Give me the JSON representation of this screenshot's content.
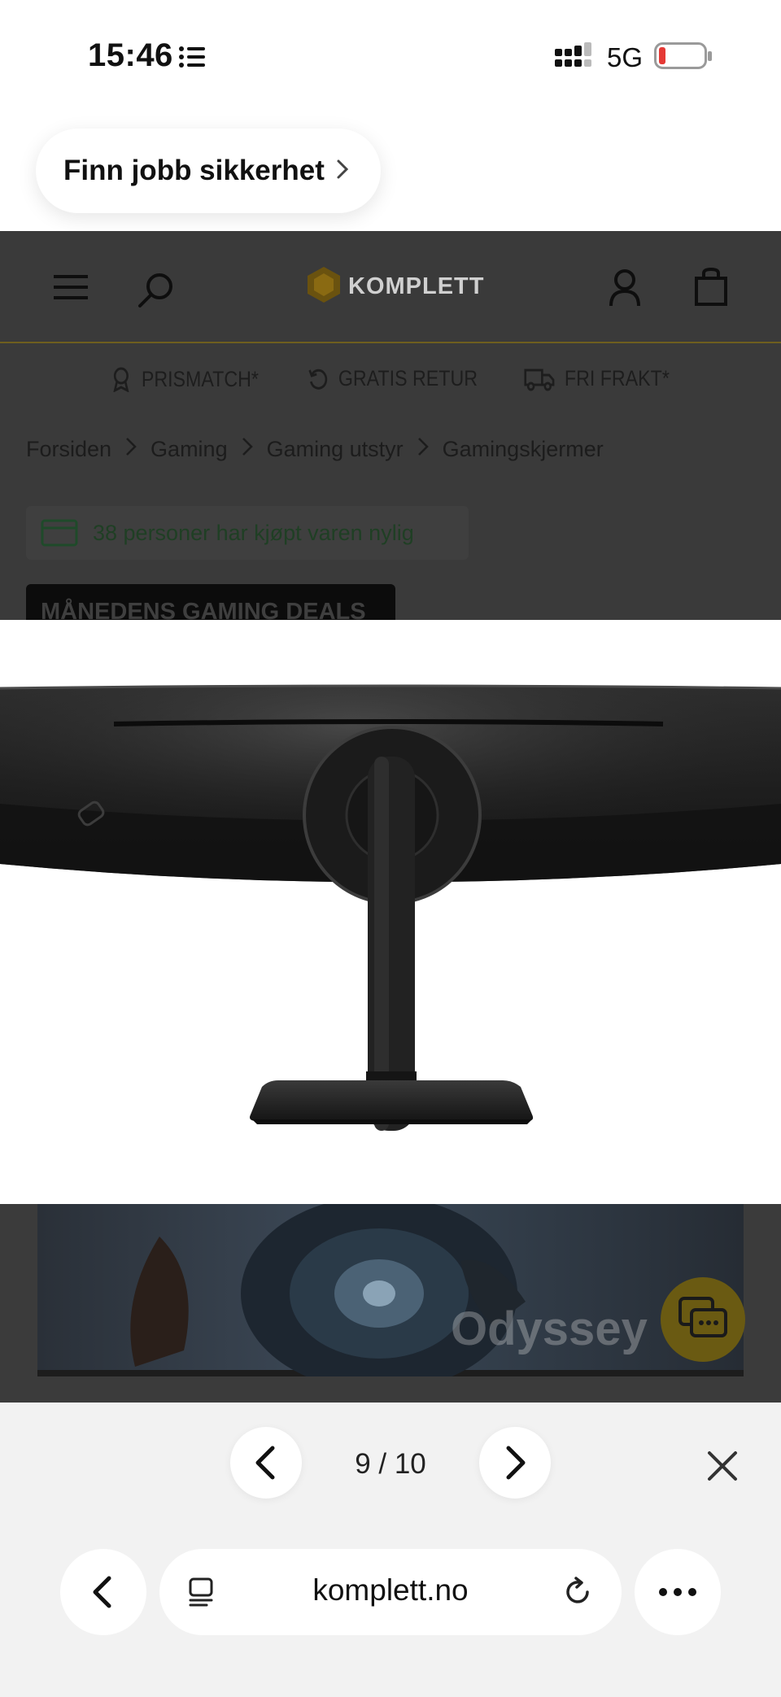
{
  "status_bar": {
    "time": "15:46",
    "network": "5G",
    "battery_color": "#e53935"
  },
  "banner": {
    "label": "Finn jobb sikkerhet"
  },
  "site": {
    "brand": "KOMPLETT",
    "accent_color": "#f5b800",
    "usps": [
      "PRISMATCH*",
      "GRATIS RETUR",
      "FRI FRAKT*"
    ],
    "breadcrumb": [
      "Forsiden",
      "Gaming",
      "Gaming utstyr",
      "Gamingskjermer"
    ],
    "recent_purchases": "38 personer har kjøpt varen nylig",
    "deals_badge": "MÅNEDENS GAMING DEALS",
    "product_watermark": "Odyssey"
  },
  "viewer": {
    "counter": "9 / 10"
  },
  "browser": {
    "url": "komplett.no"
  }
}
